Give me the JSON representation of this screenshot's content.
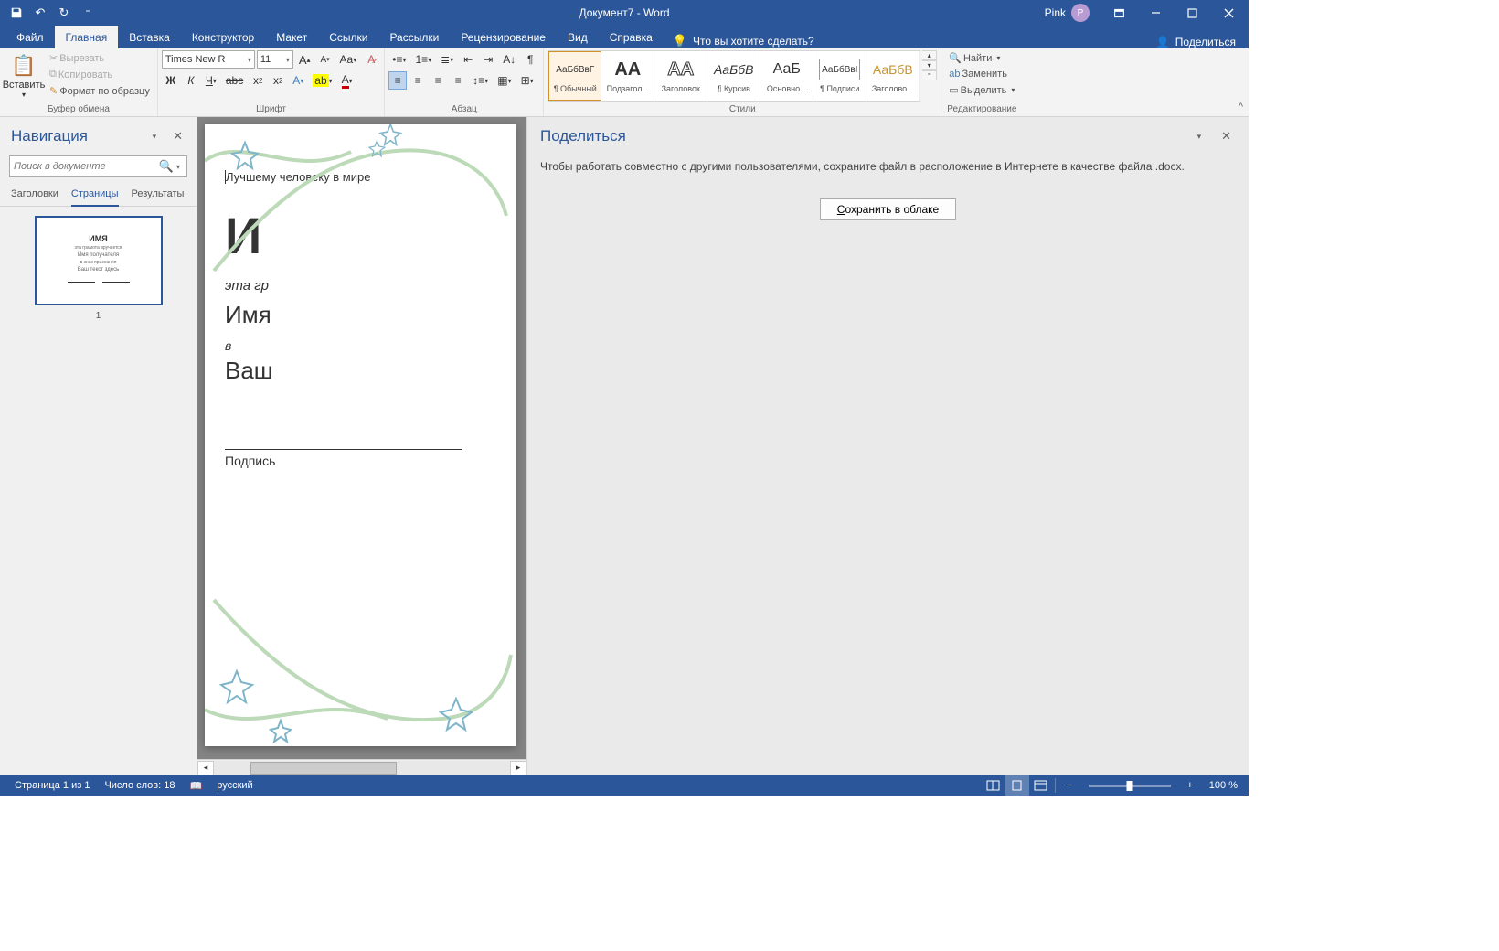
{
  "titlebar": {
    "doc_title": "Документ7 - Word",
    "user_name": "Pink",
    "user_initial": "P"
  },
  "tabs": {
    "file": "Файл",
    "home": "Главная",
    "insert": "Вставка",
    "design": "Конструктор",
    "layout": "Макет",
    "references": "Ссылки",
    "mailings": "Рассылки",
    "review": "Рецензирование",
    "view": "Вид",
    "help": "Справка",
    "tellme": "Что вы хотите сделать?",
    "share": "Поделиться"
  },
  "ribbon": {
    "clipboard": {
      "paste": "Вставить",
      "cut": "Вырезать",
      "copy": "Копировать",
      "format_painter": "Формат по образцу",
      "label": "Буфер обмена"
    },
    "font": {
      "name": "Times New R",
      "size": "11",
      "bold": "Ж",
      "italic": "К",
      "underline": "Ч",
      "label": "Шрифт"
    },
    "paragraph": {
      "label": "Абзац"
    },
    "styles": {
      "label": "Стили",
      "items": [
        {
          "preview": "АаБбВвГ",
          "name": "¶ Обычный",
          "cls": "normal",
          "sel": true
        },
        {
          "preview": "АА",
          "name": "Подзагол...",
          "cls": "big"
        },
        {
          "preview": "АА",
          "name": "Заголовок",
          "cls": "big outline"
        },
        {
          "preview": "АаБбВ",
          "name": "¶ Курсив",
          "cls": "italic"
        },
        {
          "preview": "АаБ",
          "name": "Основно...",
          "cls": "med"
        },
        {
          "preview": "АаБбВвІ",
          "name": "¶ Подписи",
          "cls": "normal box"
        },
        {
          "preview": "АаБбВ",
          "name": "Заголово...",
          "cls": "gold"
        }
      ]
    },
    "editing": {
      "find": "Найти",
      "replace": "Заменить",
      "select": "Выделить",
      "label": "Редактирование"
    }
  },
  "nav": {
    "title": "Навигация",
    "search_placeholder": "Поиск в документе",
    "tabs": {
      "headings": "Заголовки",
      "pages": "Страницы",
      "results": "Результаты"
    },
    "thumb_num": "1",
    "thumb": {
      "title": "ИМЯ",
      "line1": "эта грамота вручается",
      "line2": "Имя получателя",
      "line3": "в знак признания",
      "line4": "Ваш текст здесь"
    }
  },
  "document": {
    "line1": "Лучшему человеку в мире",
    "big": "И",
    "it": "эта гр",
    "med": "Имя",
    "it2": "в",
    "med2": "Ваш",
    "sig": "Подпись"
  },
  "share": {
    "title": "Поделиться",
    "msg": "Чтобы работать совместно с другими пользователями, сохраните файл в расположение в Интернете в качестве файла .docx.",
    "btn_pre": "С",
    "btn_rest": "охранить в облаке"
  },
  "status": {
    "page": "Страница 1 из 1",
    "words": "Число слов: 18",
    "lang": "русский",
    "zoom": "100 %"
  }
}
